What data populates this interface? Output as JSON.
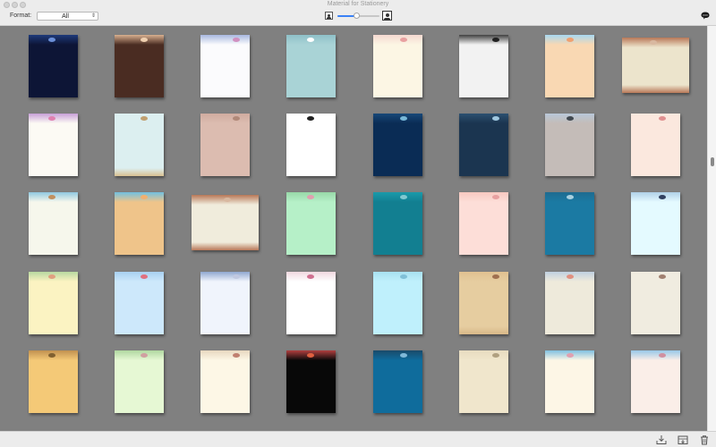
{
  "window": {
    "title": "Material for Stationery"
  },
  "toolbar": {
    "format_label": "Format:",
    "format_value": "All",
    "zoom_level": 0.45
  },
  "icons": {
    "zoom_small": "small-portrait-icon",
    "zoom_large": "large-portrait-icon",
    "chat": "speech-bubble-icon",
    "export": "download-tray-icon",
    "import": "import-box-icon",
    "delete": "trash-icon"
  },
  "gallery": {
    "scroll_position": 0.35,
    "rows": [
      [
        {
          "bg": "#0d1536",
          "top": "#1f3a7a",
          "bot": "#0d1536",
          "accent": "#6b8fd8"
        },
        {
          "bg": "#4a2c22",
          "top": "#d8b090",
          "bot": "#4a2c22",
          "accent": "#f0d0b0"
        },
        {
          "bg": "#fbfbfd",
          "top": "#a8b8e0",
          "bot": "#fbfbfd",
          "accent": "#d090c0"
        },
        {
          "bg": "#a9d3d6",
          "top": "#8fc0c8",
          "bot": "#a9d3d6",
          "accent": "#ffffff"
        },
        {
          "bg": "#fcf6e4",
          "top": "#f4d8d0",
          "bot": "#fcf6e4",
          "accent": "#e8a0a0"
        },
        {
          "bg": "#f2f2f2",
          "top": "#404040",
          "bot": "#f2f2f2",
          "accent": "#202020"
        },
        {
          "bg": "#f9d8b3",
          "top": "#a8d8f0",
          "bot": "#f9d8b3",
          "accent": "#f0a070"
        },
        {
          "bg": "#ece4cc",
          "top": "#b87858",
          "bot": "#b87858",
          "accent": "#d8b8a0",
          "wide": true
        }
      ],
      [
        {
          "bg": "#fcfaf4",
          "top": "#c8a0d8",
          "bot": "#fcfaf4",
          "accent": "#e080b0"
        },
        {
          "bg": "#dceff0",
          "top": "#dceff0",
          "bot": "#d8c090",
          "accent": "#c0a070"
        },
        {
          "bg": "#dcbcb0",
          "top": "#d0aca0",
          "bot": "#dcbcb0",
          "accent": "#b08878"
        },
        {
          "bg": "#ffffff",
          "top": "#ffffff",
          "bot": "#ffffff",
          "accent": "#202020"
        },
        {
          "bg": "#0a2c55",
          "top": "#184878",
          "bot": "#0a2c55",
          "accent": "#78b8d8"
        },
        {
          "bg": "#1b3550",
          "top": "#2c5070",
          "bot": "#1b3550",
          "accent": "#a0c8e0"
        },
        {
          "bg": "#c4bcb8",
          "top": "#b8c8d8",
          "bot": "#c4bcb8",
          "accent": "#404850"
        },
        {
          "bg": "#fbe8de",
          "top": "#fbe8de",
          "bot": "#fbe8de",
          "accent": "#e09090"
        }
      ],
      [
        {
          "bg": "#f6f7ec",
          "top": "#90c8e0",
          "bot": "#f6f7ec",
          "accent": "#c09060"
        },
        {
          "bg": "#efc48a",
          "top": "#70c0e0",
          "bot": "#efc48a",
          "accent": "#f0b070"
        },
        {
          "bg": "#f0ecdc",
          "top": "#b87858",
          "bot": "#b87858",
          "accent": "#d8b8a0",
          "wide": true
        },
        {
          "bg": "#b6f0c8",
          "top": "#98d8a8",
          "bot": "#b6f0c8",
          "accent": "#e0a0b0"
        },
        {
          "bg": "#127f91",
          "top": "#1a9aaa",
          "bot": "#127f91",
          "accent": "#80c8d0"
        },
        {
          "bg": "#fdded8",
          "top": "#f8c8c0",
          "bot": "#fdded8",
          "accent": "#e8a0a0"
        },
        {
          "bg": "#1b7aa3",
          "top": "#1e6b90",
          "bot": "#1b7aa3",
          "accent": "#a8d0e0"
        },
        {
          "bg": "#e4faff",
          "top": "#b0d0e8",
          "bot": "#e4faff",
          "accent": "#304060"
        }
      ],
      [
        {
          "bg": "#fbf3c2",
          "top": "#b8d8a0",
          "bot": "#fbf3c2",
          "accent": "#e0a080"
        },
        {
          "bg": "#cde8fb",
          "top": "#a8d0f0",
          "bot": "#cde8fb",
          "accent": "#e07080"
        },
        {
          "bg": "#f0f4fc",
          "top": "#90a8d0",
          "bot": "#f0f4fc",
          "accent": "#c0c8e0"
        },
        {
          "bg": "#ffffff",
          "top": "#f0d8e0",
          "bot": "#ffffff",
          "accent": "#d07090"
        },
        {
          "bg": "#bff0fc",
          "top": "#a8e0f0",
          "bot": "#bff0fc",
          "accent": "#80c0d8"
        },
        {
          "bg": "#e6cda0",
          "top": "#e0c090",
          "bot": "#d8b888",
          "accent": "#a07050"
        },
        {
          "bg": "#eeeadb",
          "top": "#c0d0e0",
          "bot": "#eeeadb",
          "accent": "#e09080"
        },
        {
          "bg": "#f0ece0",
          "top": "#f0ece0",
          "bot": "#f0ece0",
          "accent": "#a08070"
        }
      ],
      [
        {
          "bg": "#f4c977",
          "top": "#c09050",
          "bot": "#f4c977",
          "accent": "#806030"
        },
        {
          "bg": "#e6f8d4",
          "top": "#b0d8a0",
          "bot": "#e6f8d4",
          "accent": "#d0a0a0"
        },
        {
          "bg": "#fdf7e6",
          "top": "#e8d8c0",
          "bot": "#fdf7e6",
          "accent": "#c08070"
        },
        {
          "bg": "#080808",
          "top": "#b04040",
          "bot": "#080808",
          "accent": "#e06040"
        },
        {
          "bg": "#0f6c9c",
          "top": "#1a4a6a",
          "bot": "#0f6c9c",
          "accent": "#80b8d8"
        },
        {
          "bg": "#f0e6cc",
          "top": "#e8dcc0",
          "bot": "#f0e6cc",
          "accent": "#b0a080"
        },
        {
          "bg": "#fdf6e6",
          "top": "#80c0e0",
          "bot": "#fdf6e6",
          "accent": "#e0a0b0"
        },
        {
          "bg": "#faeee8",
          "top": "#98c8e8",
          "bot": "#faeee8",
          "accent": "#d090a0"
        }
      ]
    ]
  }
}
